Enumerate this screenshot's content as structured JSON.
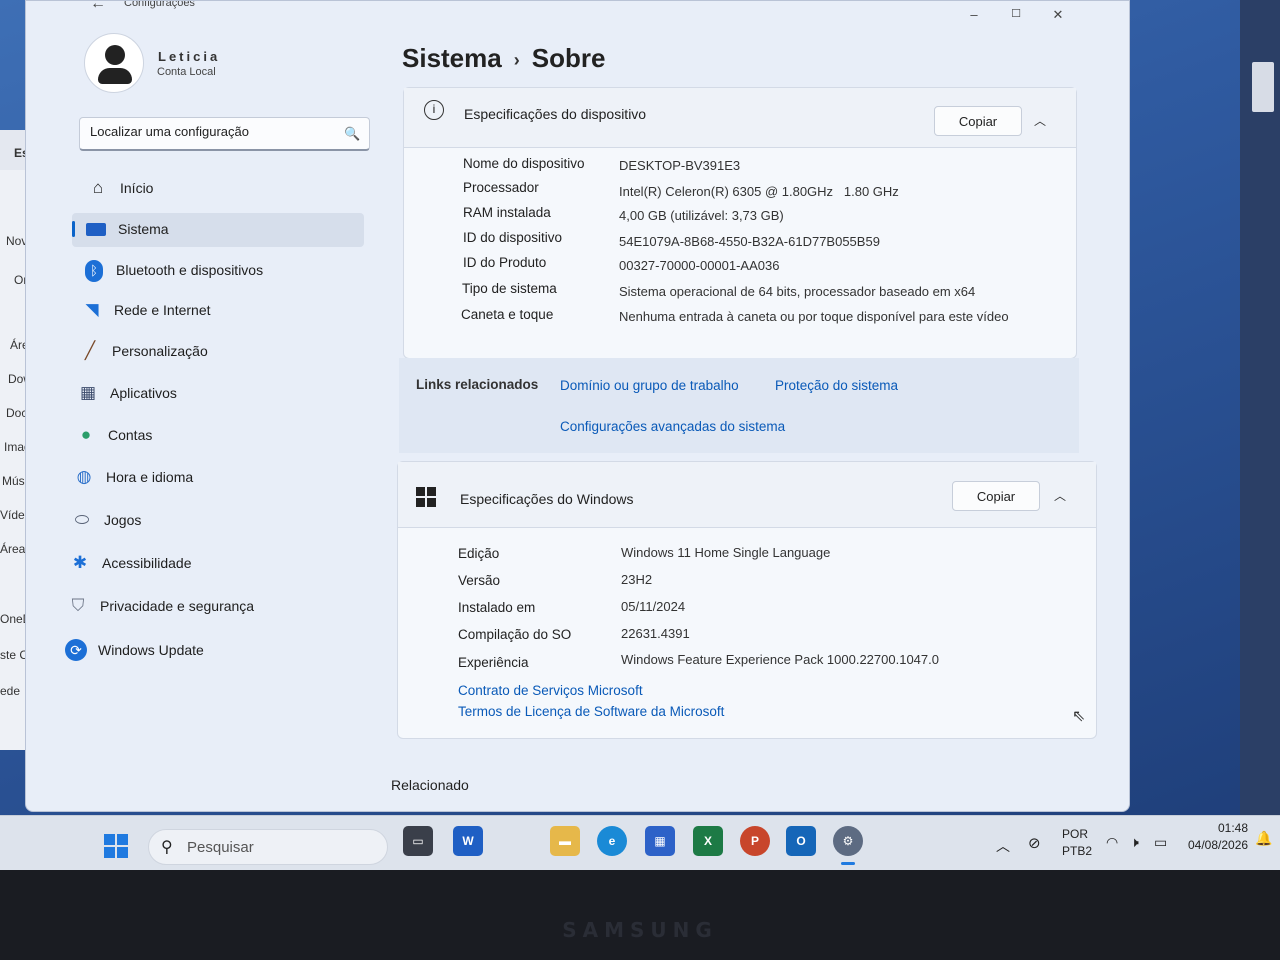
{
  "window": {
    "title": "Configurações",
    "controls": {
      "minimize": "–",
      "maximize": "☐",
      "close": "✕"
    }
  },
  "user": {
    "name": "Leticia",
    "account_type": "Conta Local"
  },
  "search": {
    "placeholder": "Localizar uma configuração"
  },
  "nav": [
    {
      "label": "Início",
      "icon": "home-icon"
    },
    {
      "label": "Sistema",
      "icon": "system-icon",
      "selected": true
    },
    {
      "label": "Bluetooth e dispositivos",
      "icon": "bluetooth-icon"
    },
    {
      "label": "Rede e Internet",
      "icon": "wifi-icon"
    },
    {
      "label": "Personalização",
      "icon": "brush-icon"
    },
    {
      "label": "Aplicativos",
      "icon": "apps-icon"
    },
    {
      "label": "Contas",
      "icon": "account-icon"
    },
    {
      "label": "Hora e idioma",
      "icon": "globe-icon"
    },
    {
      "label": "Jogos",
      "icon": "gamepad-icon"
    },
    {
      "label": "Acessibilidade",
      "icon": "accessibility-icon"
    },
    {
      "label": "Privacidade e segurança",
      "icon": "shield-icon"
    },
    {
      "label": "Windows Update",
      "icon": "update-icon"
    }
  ],
  "breadcrumb": {
    "parent": "Sistema",
    "current": "Sobre"
  },
  "device_specs": {
    "title": "Especificações do dispositivo",
    "copy_label": "Copiar",
    "rows": [
      {
        "label": "Nome do dispositivo",
        "value": "DESKTOP-BV391E3"
      },
      {
        "label": "Processador",
        "value": "Intel(R) Celeron(R) 6305 @ 1.80GHz   1.80 GHz"
      },
      {
        "label": "RAM instalada",
        "value": "4,00 GB (utilizável: 3,73 GB)"
      },
      {
        "label": "ID do dispositivo",
        "value": "54E1079A-8B68-4550-B32A-61D77B055B59"
      },
      {
        "label": "ID do Produto",
        "value": "00327-70000-00001-AA036"
      },
      {
        "label": "Tipo de sistema",
        "value": "Sistema operacional de 64 bits, processador baseado em x64"
      },
      {
        "label": "Caneta e toque",
        "value": "Nenhuma entrada à caneta ou por toque disponível para este vídeo"
      }
    ]
  },
  "related_links": {
    "label": "Links relacionados",
    "links": [
      "Domínio ou grupo de trabalho",
      "Proteção do sistema",
      "Configurações avançadas do sistema"
    ]
  },
  "windows_specs": {
    "title": "Especificações do Windows",
    "copy_label": "Copiar",
    "rows": [
      {
        "label": "Edição",
        "value": "Windows 11 Home Single Language"
      },
      {
        "label": "Versão",
        "value": "23H2"
      },
      {
        "label": "Instalado em",
        "value": "05/11/2024"
      },
      {
        "label": "Compilação do SO",
        "value": "22631.4391"
      },
      {
        "label": "Experiência",
        "value": "Windows Feature Experience Pack 1000.22700.1047.0"
      }
    ],
    "links": [
      "Contrato de Serviços Microsoft",
      "Termos de Licença de Software da Microsoft"
    ]
  },
  "related_section": "Relacionado",
  "explorer": {
    "items": [
      "Este Cor",
      "Novo",
      "OneDr",
      "Área d",
      "Downl",
      "Docun",
      "Image",
      "Música",
      "Vídeos",
      "Área d",
      "OneDr",
      "ste C",
      "ede"
    ]
  },
  "taskbar": {
    "search_placeholder": "Pesquisar",
    "lang_line1": "POR",
    "lang_line2": "PTB2",
    "time": "01:48",
    "date": "04/08/2026"
  },
  "brand_text": "SAMSUNG"
}
